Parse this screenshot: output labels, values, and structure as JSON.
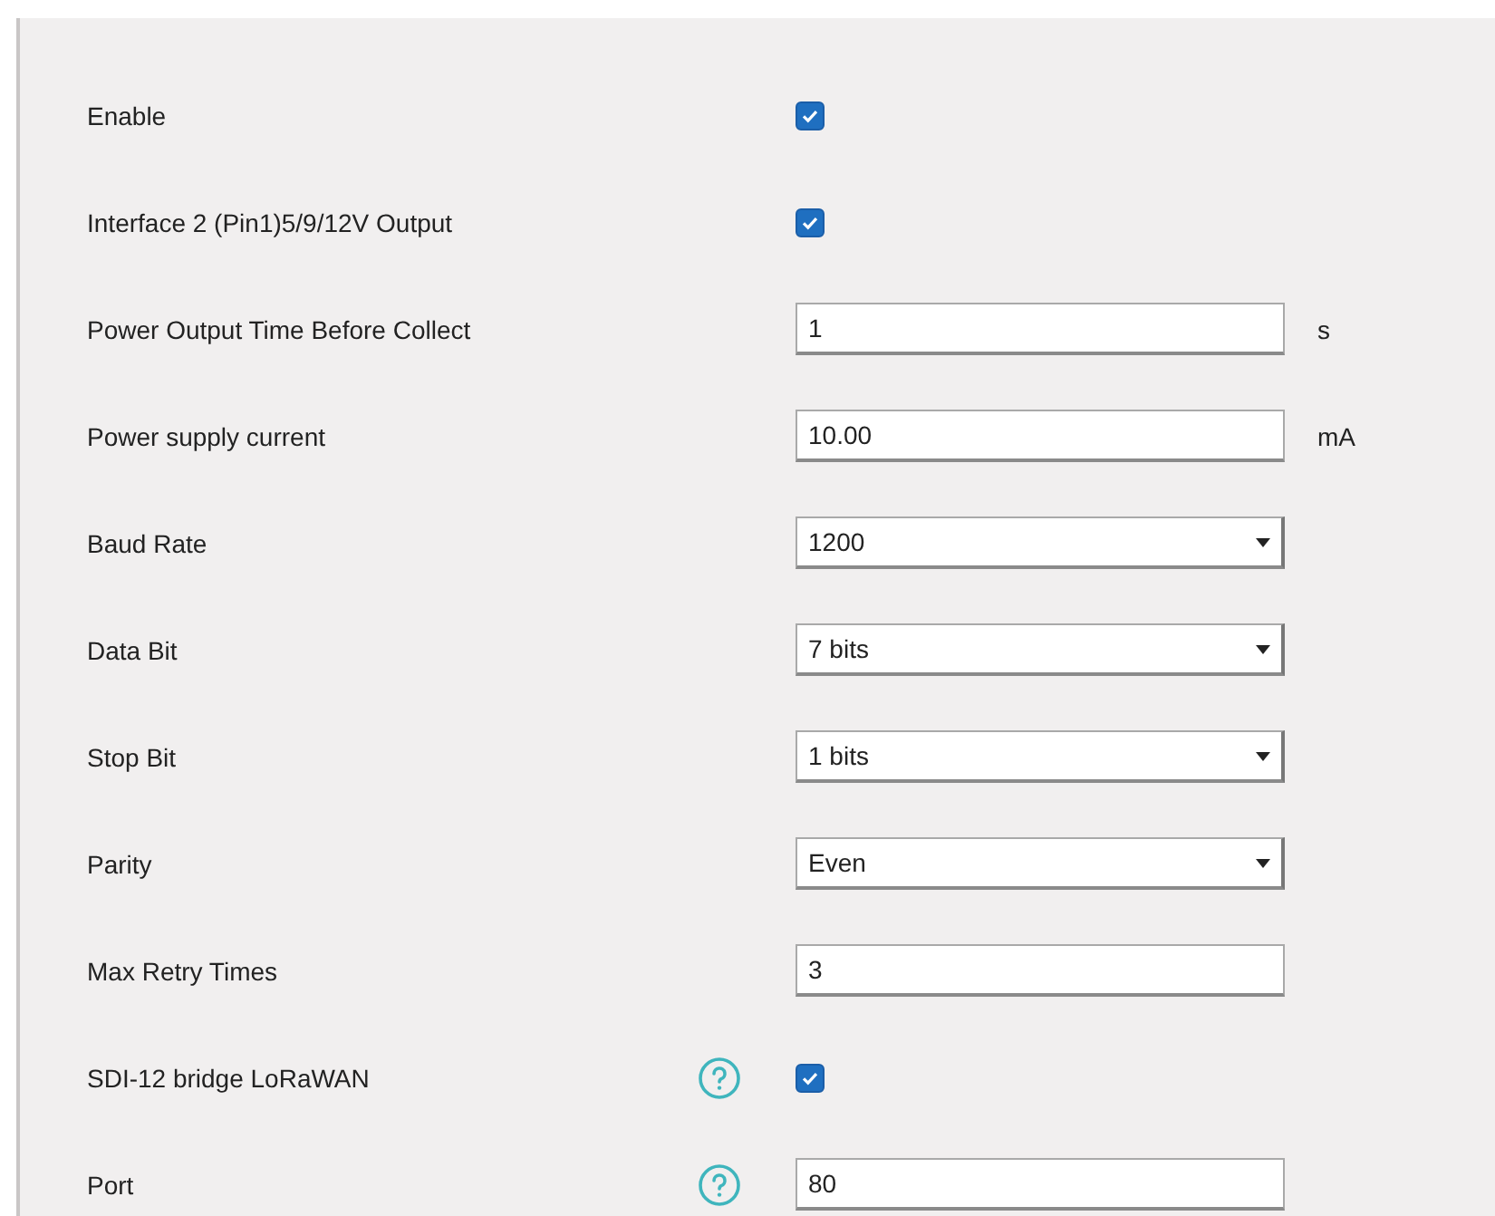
{
  "rows": [
    {
      "label": "Enable",
      "kind": "checkbox",
      "checked": true,
      "help": false
    },
    {
      "label": "Interface 2 (Pin1)5/9/12V Output",
      "kind": "checkbox",
      "checked": true,
      "help": false
    },
    {
      "label": "Power Output Time Before Collect",
      "kind": "input",
      "value": "1",
      "unit": "s",
      "help": false
    },
    {
      "label": "Power supply current",
      "kind": "input",
      "value": "10.00",
      "unit": "mA",
      "help": false
    },
    {
      "label": "Baud Rate",
      "kind": "select",
      "value": "1200",
      "help": false
    },
    {
      "label": "Data Bit",
      "kind": "select",
      "value": "7 bits",
      "help": false
    },
    {
      "label": "Stop Bit",
      "kind": "select",
      "value": "1 bits",
      "help": false
    },
    {
      "label": "Parity",
      "kind": "select",
      "value": "Even",
      "help": false
    },
    {
      "label": "Max Retry Times",
      "kind": "input",
      "value": "3",
      "help": false
    },
    {
      "label": "SDI-12 bridge LoRaWAN",
      "kind": "checkbox",
      "checked": true,
      "help": true
    },
    {
      "label": "Port",
      "kind": "input",
      "value": "80",
      "help": true
    }
  ]
}
